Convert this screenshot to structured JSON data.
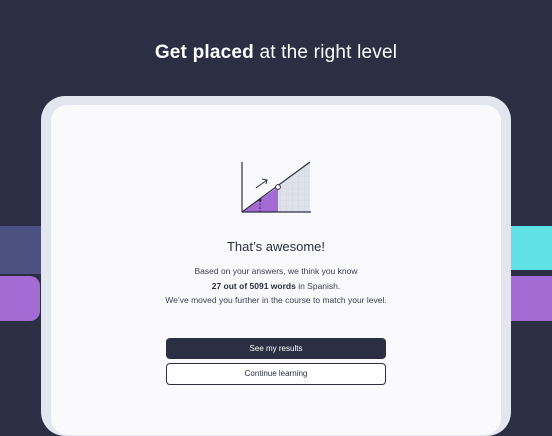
{
  "header": {
    "title_bold": "Get placed",
    "title_rest": " at the right level"
  },
  "result": {
    "heading": "That’s awesome!",
    "line1": "Based on your answers, we think you know",
    "line2_bold": "27 out of 5091 words",
    "line2_rest": " in Spanish.",
    "line3": "We’ve moved you further in the course to match your level."
  },
  "actions": {
    "primary_label": "See my results",
    "secondary_label": "Continue learning"
  },
  "colors": {
    "background": "#2c2f44",
    "accent_purple": "#a56bd4",
    "accent_cyan": "#5fe1e6",
    "accent_slate": "#4b5282"
  },
  "icons": {
    "illustration": "level-progress-chart-icon"
  }
}
